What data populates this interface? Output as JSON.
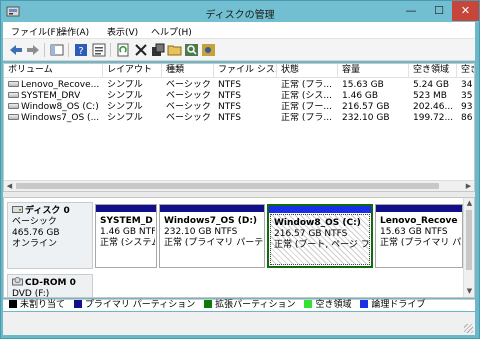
{
  "window": {
    "title": "ディスクの管理",
    "minimize": "—",
    "maximize": "☐",
    "close": "✕"
  },
  "menu": [
    "ファイル(F)",
    "操作(A)",
    "表示(V)",
    "ヘルプ(H)"
  ],
  "toolbar_icons": [
    "back-arrow-icon",
    "forward-arrow-icon",
    "console-tree-icon",
    "help-icon",
    "properties-list-icon",
    "refresh-icon",
    "delete-icon",
    "properties-icon",
    "open-folder-icon",
    "search-icon",
    "rescan-icon"
  ],
  "volumes": {
    "headers": [
      "ボリューム",
      "レイアウト",
      "種類",
      "ファイル シス...",
      "状態",
      "容量",
      "空き領域",
      "空き"
    ],
    "rows": [
      [
        "Lenovo_Recove...",
        "シンプル",
        "ベーシック",
        "NTFS",
        "正常 (プラ...",
        "15.63 GB",
        "5.24 GB",
        "34"
      ],
      [
        "SYSTEM_DRV",
        "シンプル",
        "ベーシック",
        "NTFS",
        "正常 (シス...",
        "1.46 GB",
        "523 MB",
        "35"
      ],
      [
        "Window8_OS (C:)",
        "シンプル",
        "ベーシック",
        "NTFS",
        "正常 (ブー...",
        "216.57 GB",
        "202.46...",
        "93"
      ],
      [
        "Windows7_OS (...",
        "シンプル",
        "ベーシック",
        "NTFS",
        "正常 (プラ...",
        "232.10 GB",
        "199.72...",
        "86"
      ]
    ]
  },
  "disk0": {
    "name": "ディスク 0",
    "type": "ベーシック",
    "size": "465.76 GB",
    "status": "オンライン"
  },
  "partitions": [
    {
      "name": "SYSTEM_D",
      "size": "1.46 GB NTF",
      "status": "正常 (システム"
    },
    {
      "name": "Windows7_OS  (D:)",
      "size": "232.10 GB NTFS",
      "status": "正常 (プライマリ パーティショ"
    },
    {
      "name": "Window8_OS  (C:)",
      "size": "216.57 GB NTFS",
      "status": "正常 (ブート, ページ ファ"
    },
    {
      "name": "Lenovo_Recove",
      "size": "15.63 GB NTFS",
      "status": "正常 (プライマリ パー"
    }
  ],
  "cdrom": {
    "name": "CD-ROM 0",
    "label": "DVD (F:)"
  },
  "legend": [
    {
      "label": "未割り当て",
      "color": "#000000"
    },
    {
      "label": "プライマリ パーティション",
      "color": "#10118a"
    },
    {
      "label": "拡張パーティション",
      "color": "#0c7a0c"
    },
    {
      "label": "空き領域",
      "color": "#33e033"
    },
    {
      "label": "論理ドライブ",
      "color": "#1a2ee6"
    }
  ]
}
